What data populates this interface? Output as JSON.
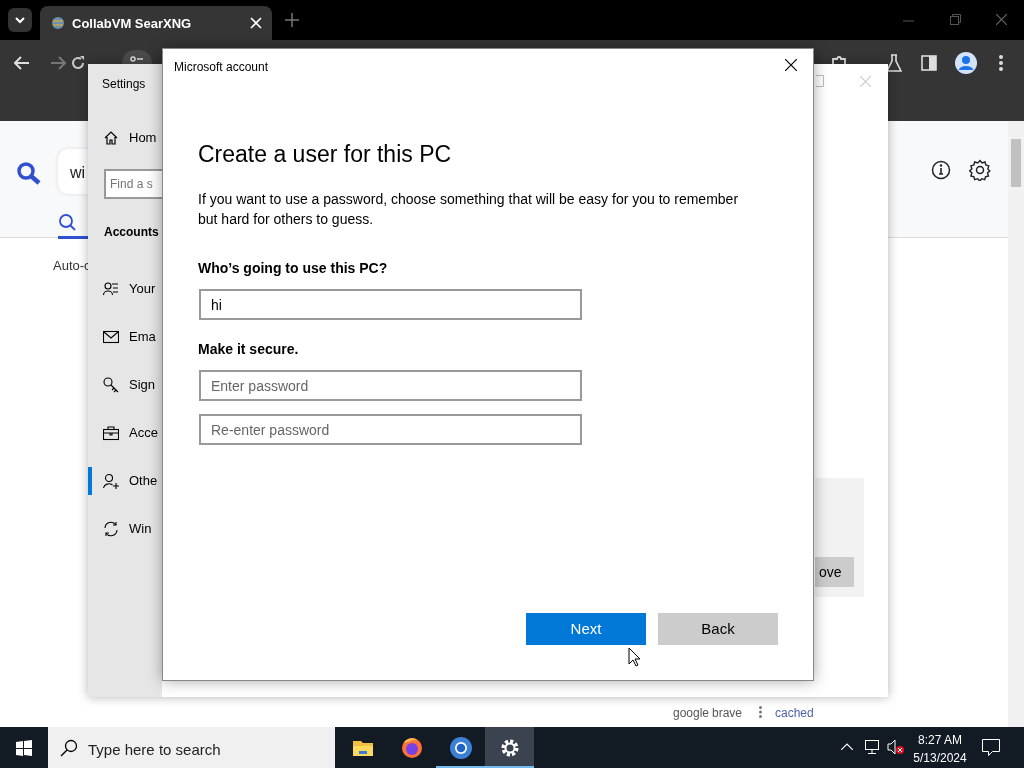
{
  "browser": {
    "tab_title": "CollabVM SearXNG",
    "search_query": "wi",
    "result_note": "Auto-c",
    "result_engines": [
      "google",
      "brave"
    ],
    "cached_link": "cached"
  },
  "settings": {
    "title": "Settings",
    "home": "Hom",
    "search_placeholder": "Find a s",
    "section": "Accounts",
    "nav": [
      {
        "label": "Your",
        "kind": "person-list",
        "selected": false
      },
      {
        "label": "Ema",
        "kind": "mail",
        "selected": false
      },
      {
        "label": "Sign",
        "kind": "key",
        "selected": false
      },
      {
        "label": "Acce",
        "kind": "briefcase",
        "selected": false
      },
      {
        "label": "Othe",
        "kind": "person-add",
        "selected": true
      },
      {
        "label": "Win",
        "kind": "sync",
        "selected": false
      }
    ],
    "remove_button": "ove"
  },
  "dialog": {
    "title": "Microsoft account",
    "heading": "Create a user for this PC",
    "description": "If you want to use a password, choose something that will be easy for you to remember but hard for others to guess.",
    "user_label": "Who’s going to use this PC?",
    "user_value": "hi",
    "secure_label": "Make it secure.",
    "password_placeholder": "Enter password",
    "reenter_placeholder": "Re-enter password",
    "buttons": [
      {
        "label": "Next",
        "kind": "primary"
      },
      {
        "label": "Back",
        "kind": "secondary"
      }
    ]
  },
  "taskbar": {
    "search_placeholder": "Type here to search",
    "apps": [
      {
        "kind": "folder",
        "running": false,
        "selected": false
      },
      {
        "kind": "firefox",
        "running": false,
        "selected": false
      },
      {
        "kind": "chromium",
        "running": true,
        "selected": false
      },
      {
        "kind": "gear",
        "running": true,
        "selected": true
      }
    ],
    "time": "8:27 AM",
    "date": "5/13/2024"
  }
}
